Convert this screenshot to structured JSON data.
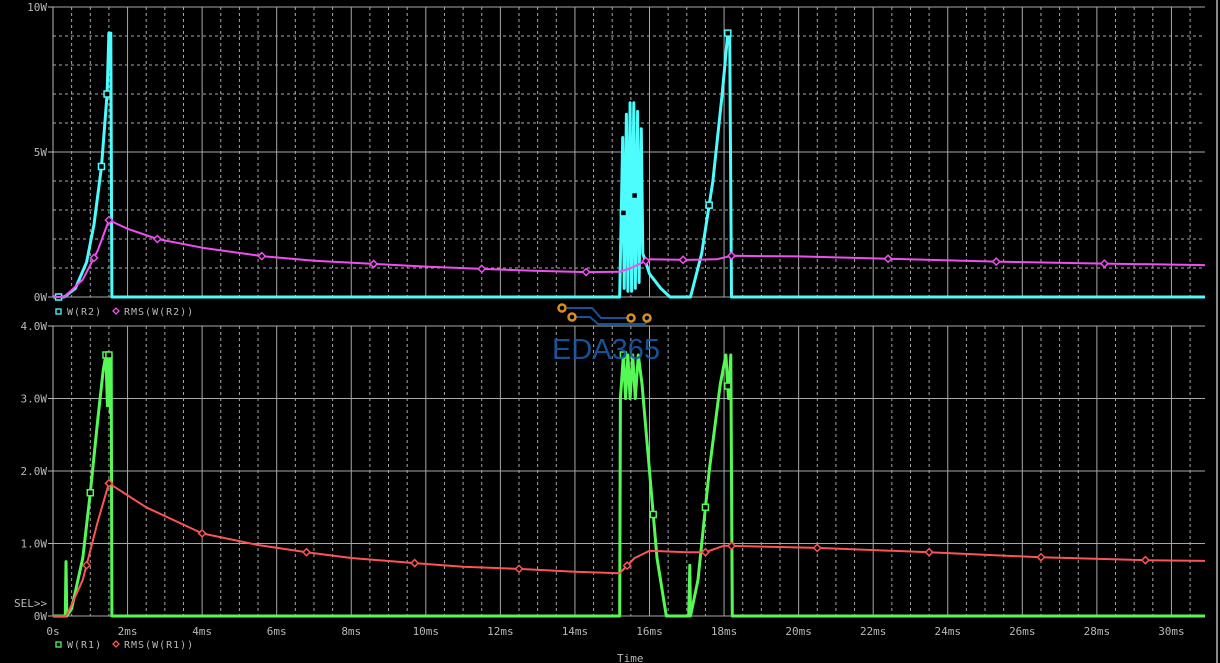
{
  "chart_data": [
    {
      "type": "line",
      "panel": "top",
      "xlabel": "Time",
      "ylim": [
        0,
        10
      ],
      "xlim": [
        0,
        30.9
      ],
      "x_unit": "ms",
      "y_ticks": [
        {
          "v": 10,
          "label": "10W"
        },
        {
          "v": 5,
          "label": "5W"
        },
        {
          "v": 0,
          "label": "0W"
        }
      ],
      "grid": true,
      "legend": [
        {
          "name": "W(R2)",
          "marker": "square",
          "color": "#4dfcfc"
        },
        {
          "name": "RMS(W(R2))",
          "marker": "diamond",
          "color": "#f04ef0"
        }
      ],
      "series": [
        {
          "name": "W(R2)",
          "color": "#4dfcfc",
          "width": 3,
          "points": [
            [
              0,
              0
            ],
            [
              0.3,
              0
            ],
            [
              0.6,
              0.3
            ],
            [
              0.9,
              1.2
            ],
            [
              1.1,
              2.5
            ],
            [
              1.3,
              4.5
            ],
            [
              1.45,
              7
            ],
            [
              1.5,
              9.1
            ],
            [
              1.55,
              9.1
            ],
            [
              1.58,
              0
            ],
            [
              15.2,
              0
            ],
            [
              15.28,
              5.5
            ],
            [
              15.32,
              0.3
            ],
            [
              15.38,
              6.3
            ],
            [
              15.42,
              0.2
            ],
            [
              15.48,
              6.7
            ],
            [
              15.52,
              0.2
            ],
            [
              15.58,
              6.7
            ],
            [
              15.62,
              0.3
            ],
            [
              15.68,
              6.4
            ],
            [
              15.72,
              0.5
            ],
            [
              15.78,
              5.8
            ],
            [
              15.82,
              1.5
            ],
            [
              16.0,
              0.8
            ],
            [
              16.3,
              0.3
            ],
            [
              16.55,
              0
            ],
            [
              17.1,
              0
            ],
            [
              17.4,
              1.5
            ],
            [
              17.7,
              4
            ],
            [
              17.95,
              7
            ],
            [
              18.1,
              9.1
            ],
            [
              18.15,
              9.1
            ],
            [
              18.2,
              0
            ],
            [
              30.9,
              0
            ]
          ],
          "markers": [
            0.15,
            1.3,
            1.45,
            15.3,
            15.6,
            17.6,
            18.1
          ]
        },
        {
          "name": "RMS(W(R2))",
          "color": "#f04ef0",
          "width": 2,
          "points": [
            [
              0,
              0
            ],
            [
              0.3,
              0
            ],
            [
              0.8,
              0.6
            ],
            [
              1.2,
              1.6
            ],
            [
              1.5,
              2.65
            ],
            [
              2,
              2.35
            ],
            [
              2.8,
              2.0
            ],
            [
              4,
              1.7
            ],
            [
              5.6,
              1.41
            ],
            [
              7,
              1.25
            ],
            [
              8.6,
              1.14
            ],
            [
              10,
              1.05
            ],
            [
              11.5,
              0.97
            ],
            [
              13,
              0.9
            ],
            [
              14.3,
              0.86
            ],
            [
              15.2,
              0.87
            ],
            [
              15.5,
              1.0
            ],
            [
              16,
              1.3
            ],
            [
              17,
              1.28
            ],
            [
              17.8,
              1.3
            ],
            [
              18.2,
              1.42
            ],
            [
              20,
              1.4
            ],
            [
              22.4,
              1.32
            ],
            [
              25.3,
              1.22
            ],
            [
              28.2,
              1.15
            ],
            [
              30.9,
              1.1
            ]
          ],
          "markers": [
            1.1,
            1.5,
            2.8,
            5.6,
            8.6,
            11.5,
            14.3,
            15.9,
            16.9,
            18.2,
            22.4,
            25.3,
            28.2
          ]
        }
      ]
    },
    {
      "type": "line",
      "panel": "bottom",
      "xlabel": "Time",
      "ylim": [
        0,
        4
      ],
      "xlim": [
        0,
        30.9
      ],
      "x_unit": "ms",
      "y_ticks": [
        {
          "v": 4,
          "label": "4.0W"
        },
        {
          "v": 3,
          "label": "3.0W"
        },
        {
          "v": 2,
          "label": "2.0W"
        },
        {
          "v": 1,
          "label": "1.0W"
        },
        {
          "v": 0,
          "label": "0W"
        }
      ],
      "x_ticks": [
        {
          "v": 0,
          "label": "0s"
        },
        {
          "v": 2,
          "label": "2ms"
        },
        {
          "v": 4,
          "label": "4ms"
        },
        {
          "v": 6,
          "label": "6ms"
        },
        {
          "v": 8,
          "label": "8ms"
        },
        {
          "v": 10,
          "label": "10ms"
        },
        {
          "v": 12,
          "label": "12ms"
        },
        {
          "v": 14,
          "label": "14ms"
        },
        {
          "v": 16,
          "label": "16ms"
        },
        {
          "v": 18,
          "label": "18ms"
        },
        {
          "v": 20,
          "label": "20ms"
        },
        {
          "v": 22,
          "label": "22ms"
        },
        {
          "v": 24,
          "label": "24ms"
        },
        {
          "v": 26,
          "label": "26ms"
        },
        {
          "v": 28,
          "label": "28ms"
        },
        {
          "v": 30,
          "label": "30ms"
        }
      ],
      "grid": true,
      "legend": [
        {
          "name": "W(R1)",
          "marker": "square",
          "color": "#55f855"
        },
        {
          "name": "RMS(W(R1))",
          "marker": "diamond",
          "color": "#fc5454"
        }
      ],
      "series": [
        {
          "name": "W(R1)",
          "color": "#55f855",
          "width": 3,
          "points": [
            [
              0,
              0
            ],
            [
              0.33,
              0
            ],
            [
              0.35,
              0.75
            ],
            [
              0.37,
              0
            ],
            [
              0.5,
              0.1
            ],
            [
              0.8,
              0.8
            ],
            [
              1.0,
              1.7
            ],
            [
              1.2,
              2.7
            ],
            [
              1.35,
              3.4
            ],
            [
              1.42,
              3.6
            ],
            [
              1.46,
              2.9
            ],
            [
              1.5,
              3.6
            ],
            [
              1.54,
              2.8
            ],
            [
              1.56,
              3.6
            ],
            [
              1.58,
              0
            ],
            [
              15.2,
              0
            ],
            [
              15.22,
              3.0
            ],
            [
              15.3,
              3.6
            ],
            [
              15.36,
              3.0
            ],
            [
              15.42,
              3.6
            ],
            [
              15.48,
              3.0
            ],
            [
              15.55,
              3.6
            ],
            [
              15.62,
              3.0
            ],
            [
              15.7,
              3.6
            ],
            [
              15.8,
              3.2
            ],
            [
              16.0,
              2.0
            ],
            [
              16.2,
              0.8
            ],
            [
              16.45,
              0
            ],
            [
              17.05,
              0
            ],
            [
              17.08,
              0.7
            ],
            [
              17.1,
              0
            ],
            [
              17.3,
              0.5
            ],
            [
              17.6,
              2
            ],
            [
              17.9,
              3.2
            ],
            [
              18.05,
              3.6
            ],
            [
              18.12,
              3.0
            ],
            [
              18.18,
              3.6
            ],
            [
              18.22,
              0
            ],
            [
              30.9,
              0
            ]
          ],
          "markers": [
            1.0,
            1.42,
            1.5,
            15.3,
            16.1,
            17.5,
            18.1
          ]
        },
        {
          "name": "RMS(W(R1))",
          "color": "#fc5454",
          "width": 2,
          "points": [
            [
              0,
              0
            ],
            [
              0.35,
              0
            ],
            [
              0.45,
              0.1
            ],
            [
              0.8,
              0.5
            ],
            [
              1.2,
              1.3
            ],
            [
              1.5,
              1.83
            ],
            [
              2.5,
              1.5
            ],
            [
              4,
              1.14
            ],
            [
              5.5,
              0.98
            ],
            [
              6.8,
              0.88
            ],
            [
              8,
              0.8
            ],
            [
              9.7,
              0.73
            ],
            [
              11,
              0.68
            ],
            [
              12.5,
              0.65
            ],
            [
              14,
              0.61
            ],
            [
              15.2,
              0.59
            ],
            [
              15.6,
              0.8
            ],
            [
              16,
              0.9
            ],
            [
              17,
              0.88
            ],
            [
              17.5,
              0.88
            ],
            [
              18,
              0.97
            ],
            [
              20.5,
              0.94
            ],
            [
              23.5,
              0.88
            ],
            [
              26.5,
              0.81
            ],
            [
              29.3,
              0.77
            ],
            [
              30.9,
              0.76
            ]
          ],
          "markers": [
            0.9,
            1.5,
            4,
            6.8,
            9.7,
            12.5,
            15.4,
            17.5,
            18.2,
            20.5,
            23.5,
            26.5,
            29.3
          ]
        }
      ]
    }
  ],
  "labels": {
    "sel": "SEL>>",
    "time_axis": "Time"
  },
  "watermark": "EDA365"
}
